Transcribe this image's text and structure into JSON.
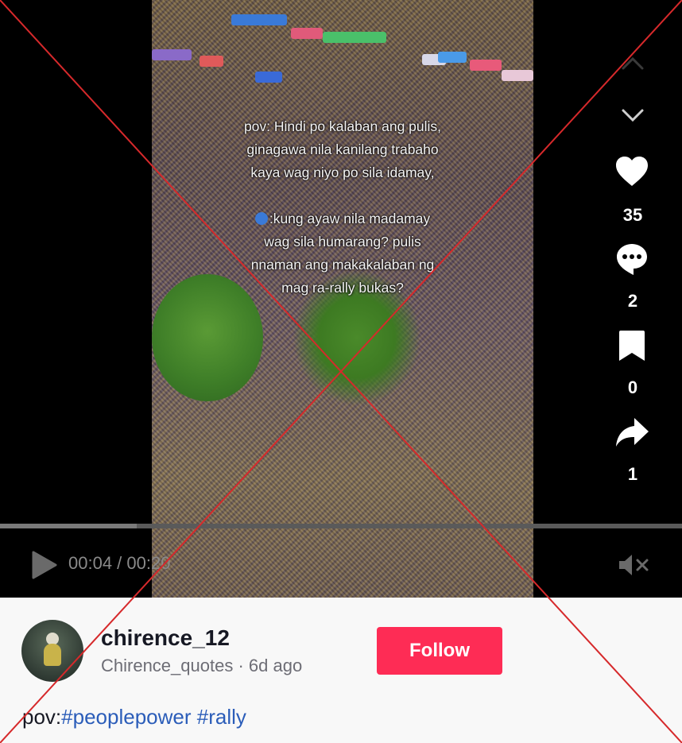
{
  "video": {
    "overlay_lines": [
      "pov: Hindi po kalaban ang pulis,",
      "ginagawa nila kanilang trabaho",
      "kaya wag niyo po sila idamay,",
      "",
      ":kung ayaw nila madamay",
      "wag sila humarang? pulis",
      "nnaman ang makakalaban ng",
      "mag ra-rally bukas?"
    ]
  },
  "sidebar": {
    "up_icon": "chevron-up-icon",
    "down_icon": "chevron-down-icon",
    "likes": "35",
    "comments": "2",
    "bookmarks": "0",
    "shares": "1"
  },
  "controls": {
    "time": "00:04 / 00:20",
    "progress": 0.2,
    "play_icon": "play-icon",
    "mute_icon": "muted-speaker-icon"
  },
  "author": {
    "username": "chirence_12",
    "display_name": "Chirence_quotes",
    "posted": "6d ago",
    "follow_label": "Follow"
  },
  "caption": {
    "prefix": "pov:",
    "tag1": "#peoplepower",
    "tag2": "#rally"
  },
  "colors": {
    "accent": "#fe2c55",
    "hashtag": "#2b5db9",
    "cross": "#d6292b"
  }
}
